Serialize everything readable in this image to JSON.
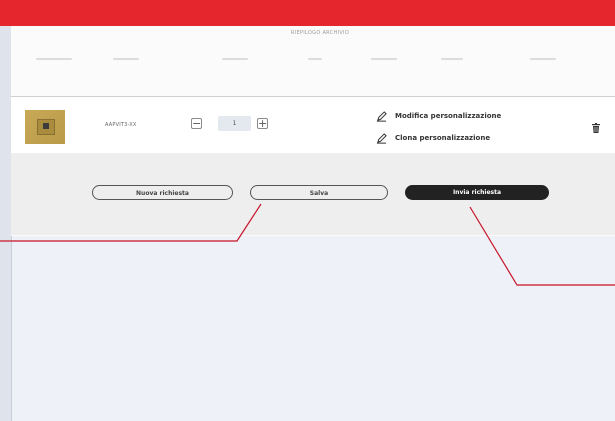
{
  "section": {
    "title": "RIEPILOGO ARCHIVIO"
  },
  "item": {
    "sku": "AAPVIT3-XX",
    "quantity": "1",
    "decrease_symbol": "−",
    "increase_symbol": "+"
  },
  "actions": {
    "edit_label": "Modifica personalizzazione",
    "clone_label": "Clona personalizzazione"
  },
  "footer": {
    "new_request_label": "Nuova richiesta",
    "save_label": "Salva",
    "send_request_label": "Invia richiesta"
  },
  "colors": {
    "brand_red": "#e5262d",
    "dark_button": "#222222",
    "callout_red": "#c8142a"
  },
  "icons": [
    "pencil-icon",
    "trash-icon"
  ]
}
